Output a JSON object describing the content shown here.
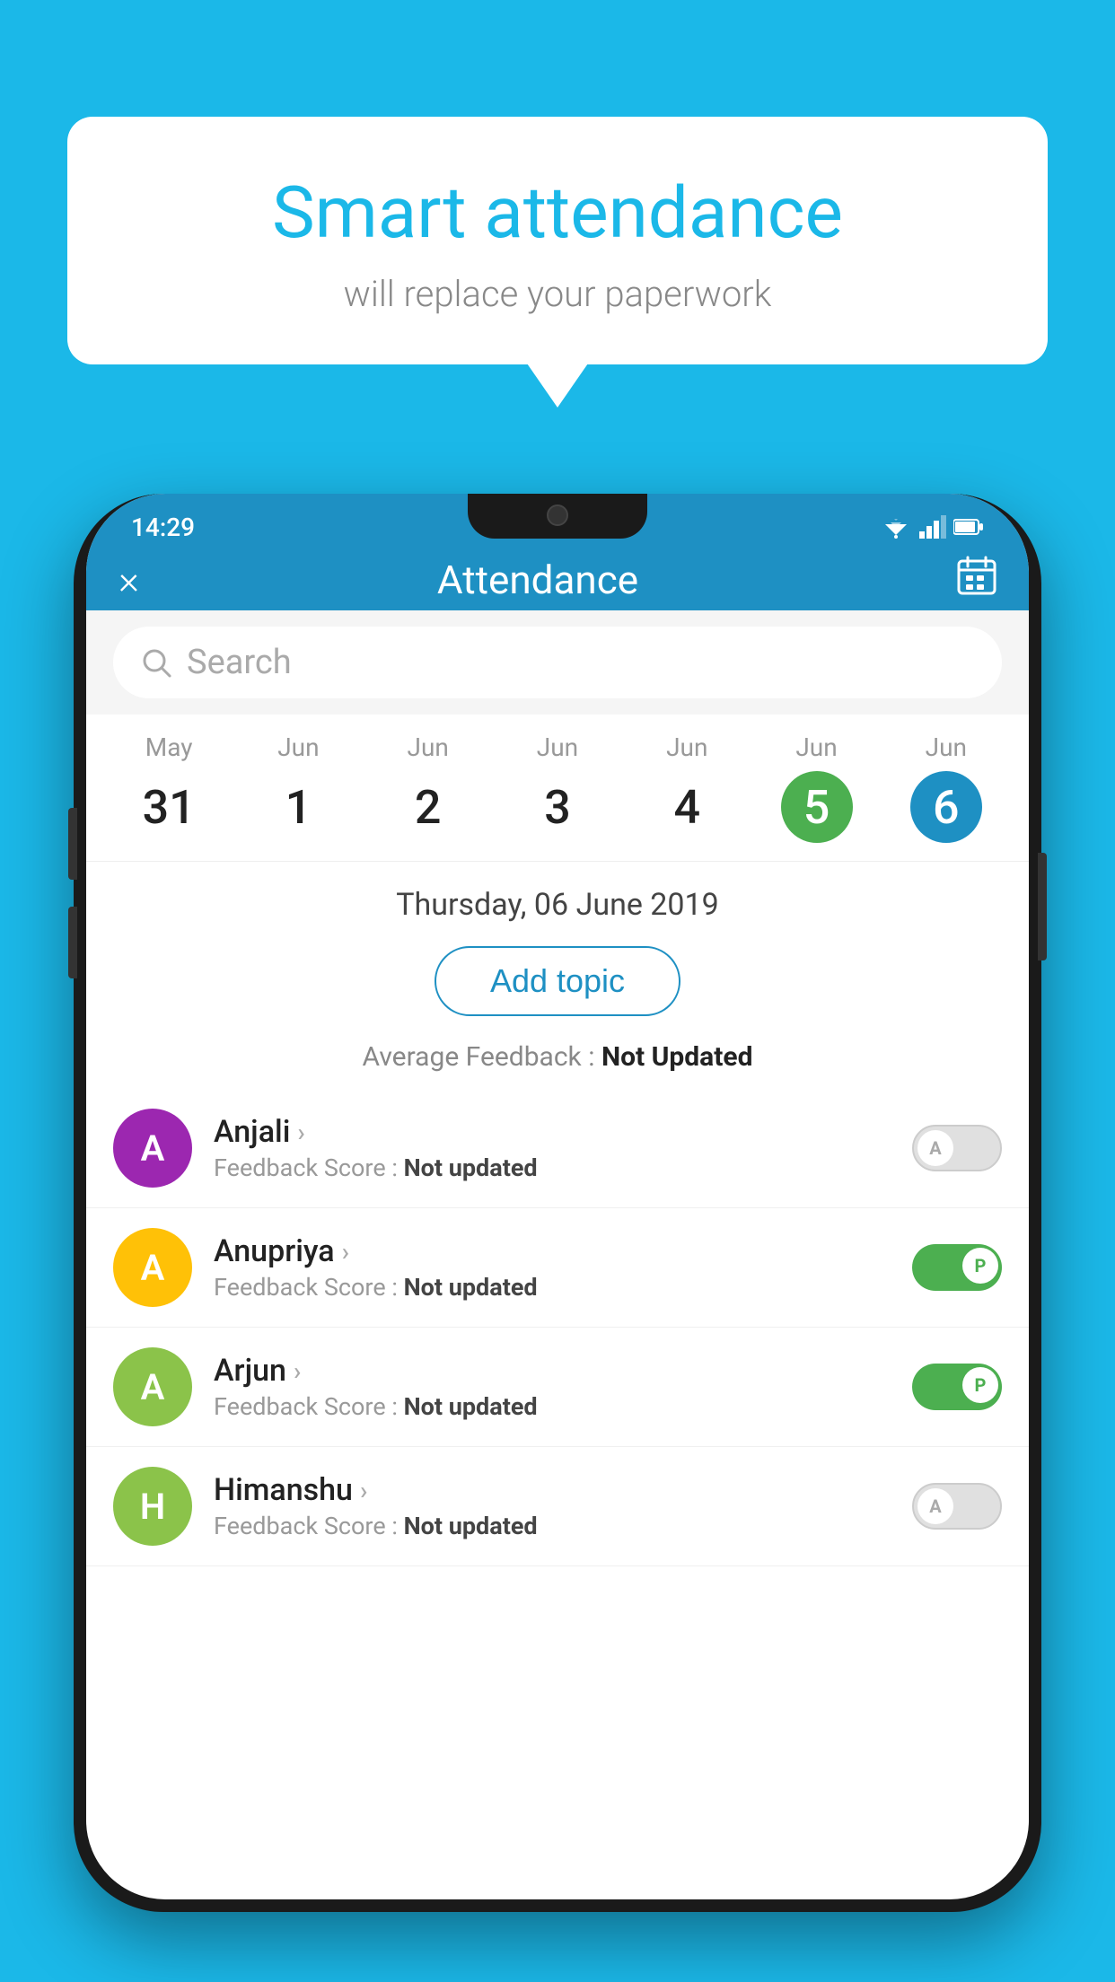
{
  "background_color": "#1BB8E8",
  "bubble": {
    "title": "Smart attendance",
    "subtitle": "will replace your paperwork"
  },
  "status_bar": {
    "time": "14:29",
    "wifi": "▾",
    "signal": "▲",
    "battery": "▮"
  },
  "header": {
    "title": "Attendance",
    "close_label": "×",
    "calendar_label": "📅"
  },
  "search": {
    "placeholder": "Search"
  },
  "dates": [
    {
      "month": "May",
      "day": "31",
      "state": "normal"
    },
    {
      "month": "Jun",
      "day": "1",
      "state": "normal"
    },
    {
      "month": "Jun",
      "day": "2",
      "state": "normal"
    },
    {
      "month": "Jun",
      "day": "3",
      "state": "normal"
    },
    {
      "month": "Jun",
      "day": "4",
      "state": "normal"
    },
    {
      "month": "Jun",
      "day": "5",
      "state": "today"
    },
    {
      "month": "Jun",
      "day": "6",
      "state": "selected"
    }
  ],
  "selected_date_label": "Thursday, 06 June 2019",
  "add_topic_label": "Add topic",
  "avg_feedback_label": "Average Feedback :",
  "avg_feedback_value": "Not Updated",
  "students": [
    {
      "name": "Anjali",
      "feedback_label": "Feedback Score :",
      "feedback_value": "Not updated",
      "avatar_letter": "A",
      "avatar_color": "#9C27B0",
      "attendance": "absent"
    },
    {
      "name": "Anupriya",
      "feedback_label": "Feedback Score :",
      "feedback_value": "Not updated",
      "avatar_letter": "A",
      "avatar_color": "#FFC107",
      "attendance": "present"
    },
    {
      "name": "Arjun",
      "feedback_label": "Feedback Score :",
      "feedback_value": "Not updated",
      "avatar_letter": "A",
      "avatar_color": "#8BC34A",
      "attendance": "present"
    },
    {
      "name": "Himanshu",
      "feedback_label": "Feedback Score :",
      "feedback_value": "Not updated",
      "avatar_letter": "H",
      "avatar_color": "#8BC34A",
      "attendance": "absent"
    }
  ],
  "toggle_present_label": "P",
  "toggle_absent_label": "A"
}
